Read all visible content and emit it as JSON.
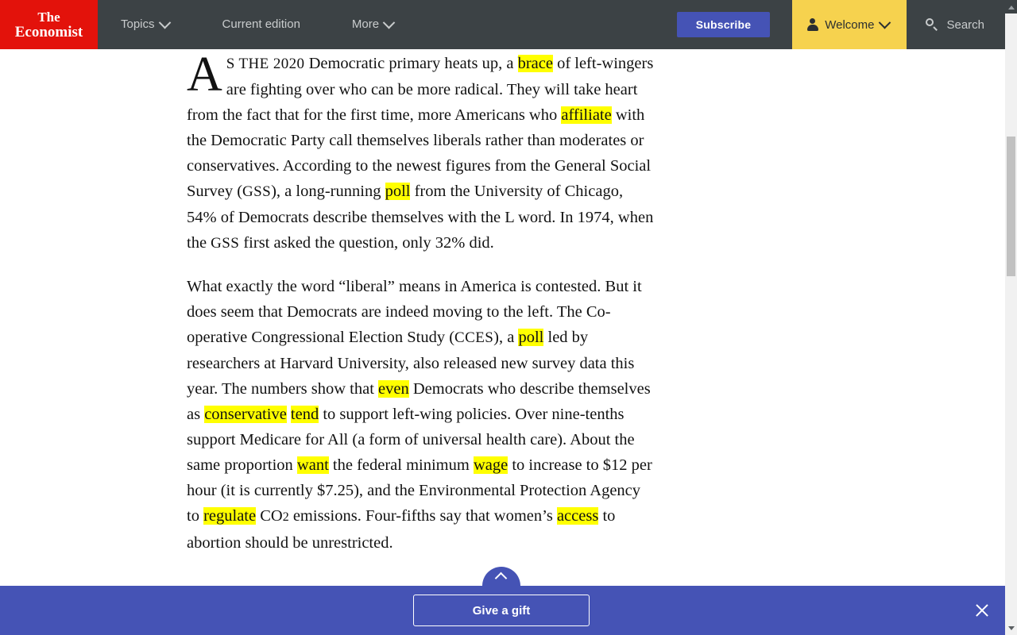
{
  "header": {
    "logo": {
      "line1": "The",
      "line2": "Economist"
    },
    "nav": [
      {
        "label": "Topics",
        "has_chevron": true,
        "icon": "chevron-down-icon"
      },
      {
        "label": "Current edition",
        "has_chevron": false,
        "icon": ""
      },
      {
        "label": "More",
        "has_chevron": true,
        "icon": "chevron-down-icon"
      }
    ],
    "subscribe_label": "Subscribe",
    "welcome_label": "Welcome",
    "welcome_icon": "person-icon",
    "welcome_chevron_icon": "chevron-down-icon",
    "search_label": "Search",
    "search_icon": "search-icon",
    "colors": {
      "bar": "#3c4245",
      "logo_red": "#e3120b",
      "subscribe_blue": "#4553b5",
      "welcome_yellow": "#f6d24e",
      "nav_text": "#c9cccd"
    }
  },
  "article": {
    "paragraph1": {
      "dropcap": "A",
      "smallcaps": "S THE 2020",
      "seg1": " Democratic primary heats up, a ",
      "hl1": "brace",
      "seg2": " of left-wingers are fighting over who can be more radical. They will take heart from the fact that for the first time, more Americans who ",
      "hl2": "affiliate",
      "seg3": " with the Democratic Party call themselves liberals rather than moderates or conservatives. According to the newest figures from the General Social Survey (",
      "sc_gss1": "GSS",
      "seg4": "), a long-running ",
      "hl3": "poll",
      "seg5": " from the University of Chicago, 54% of Democrats describe themselves with the L word. In 1974, when the ",
      "sc_gss2": "GSS",
      "seg6": " first asked the question, only 32% did."
    },
    "paragraph2": {
      "seg1": "What exactly the word “liberal” means in America is contested. But it does seem that Democrats are indeed moving to the left. The Co-operative Congressional Election Study (",
      "sc_cces": "CCES",
      "seg2": "), a ",
      "hl1": "poll",
      "seg3": " led by researchers at Harvard University, also released new survey data this year. The numbers show that ",
      "hl2": "even",
      "seg4": " Democrats who describe themselves as ",
      "hl3": "conservative",
      "seg5": " ",
      "hl4": "tend",
      "seg6": " to support left-wing policies. Over nine-tenths support Medicare for All (a form of universal health care). About the same proportion ",
      "hl5": "want",
      "seg7": " the federal minimum ",
      "hl6": "wage",
      "seg8": " to increase to $12 per hour (it is currently $7.25), and the Environmental Protection Agency to ",
      "hl7": "regulate",
      "seg9": " CO",
      "co2_sub": "2",
      "seg10": " emissions. Four-fifths say that women’s ",
      "hl8": "access",
      "seg11": " to abortion should be unrestricted."
    },
    "highlight_color": "#ffff00"
  },
  "bottom_banner": {
    "gift_label": "Give a gift",
    "close_icon": "close-icon",
    "scroll_top_icon": "chevron-up-icon",
    "background": "#4553b5"
  },
  "scrollbar": {
    "up_arrow_icon": "caret-up-icon",
    "down_arrow_icon": "caret-down-icon",
    "thumb_name": "scrollbar-thumb"
  }
}
